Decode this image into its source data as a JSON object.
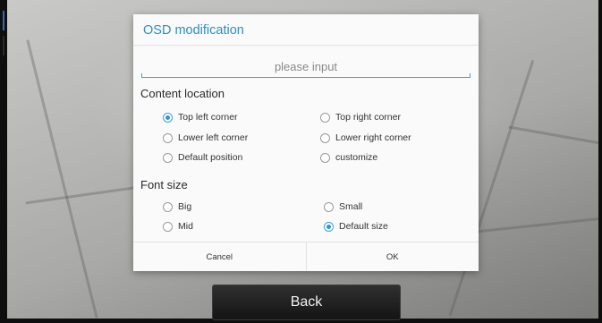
{
  "dialog": {
    "title": "OSD modification",
    "input": {
      "placeholder": "please input",
      "value": ""
    },
    "content_location": {
      "label": "Content location",
      "selected": "Top left corner",
      "options": [
        "Top left corner",
        "Top right corner",
        "Lower left corner",
        "Lower right corner",
        "Default position",
        "customize"
      ]
    },
    "font_size": {
      "label": "Font size",
      "selected": "Default size",
      "options": [
        "Big",
        "Small",
        "Mid",
        "Default size"
      ]
    },
    "buttons": {
      "cancel": "Cancel",
      "ok": "OK"
    }
  },
  "back_button": "Back",
  "colors": {
    "accent": "#2f8dbf",
    "radio_checked": "#2f96d1"
  }
}
